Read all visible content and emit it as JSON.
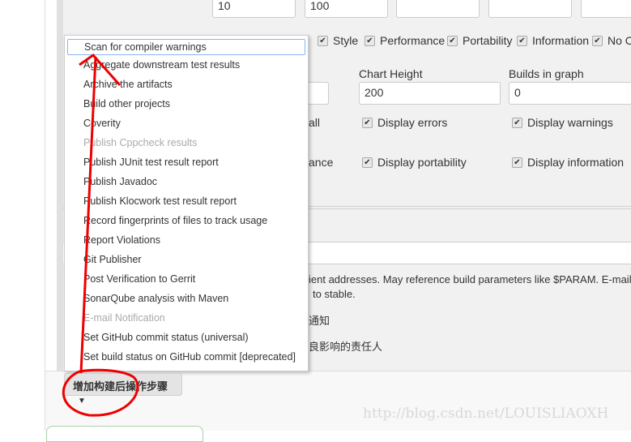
{
  "top_inputs": [
    "10",
    "100",
    "",
    "",
    ""
  ],
  "priority_checks": [
    "Style",
    "Performance",
    "Portability",
    "Information",
    "No C"
  ],
  "chart": {
    "height_label": "Chart Height",
    "height_value": "200",
    "builds_label": "Builds in graph",
    "builds_value": "0"
  },
  "display_checks": {
    "row1_partial": "all",
    "errors": "Display errors",
    "warnings": "Display warnings",
    "row2_partial": "ance",
    "portability": "Display portability",
    "information": "Display information"
  },
  "email": {
    "help_line1": "ient addresses. May reference build parameters like $PARAM. E-mail w",
    "help_line2": "to stable.",
    "opt1": "通知",
    "opt2": "良影响的责任人"
  },
  "menu": {
    "items": [
      {
        "label": "Scan for compiler warnings",
        "state": "selected"
      },
      {
        "label": "Aggregate downstream test results"
      },
      {
        "label": "Archive the artifacts"
      },
      {
        "label": "Build other projects"
      },
      {
        "label": "Coverity"
      },
      {
        "label": "Publish Cppcheck results",
        "state": "disabled"
      },
      {
        "label": "Publish JUnit test result report"
      },
      {
        "label": "Publish Javadoc"
      },
      {
        "label": "Publish Klocwork test result report"
      },
      {
        "label": "Record fingerprints of files to track usage"
      },
      {
        "label": "Report Violations"
      },
      {
        "label": "Git Publisher"
      },
      {
        "label": "Post Verification to Gerrit"
      },
      {
        "label": "SonarQube analysis with Maven"
      },
      {
        "label": "E-mail Notification",
        "state": "disabled"
      },
      {
        "label": "Set GitHub commit status (universal)"
      },
      {
        "label": "Set build status on GitHub commit [deprecated]"
      }
    ]
  },
  "add_button": "增加构建后操作步骤",
  "watermark": "http://blog.csdn.net/LOUISLIAOXH",
  "annotation_color": "#ff0000"
}
